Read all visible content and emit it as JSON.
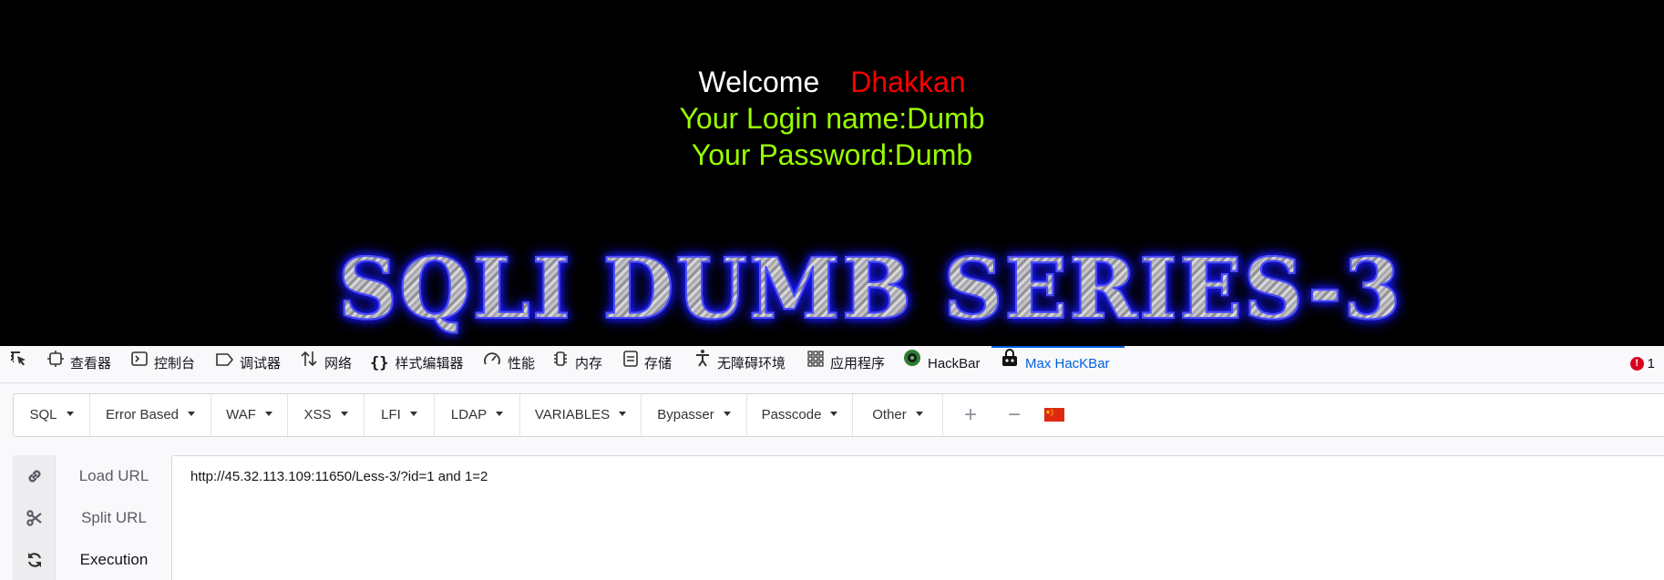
{
  "web": {
    "welcome": "Welcome",
    "username": "Dhakkan",
    "login_name": "Your Login name:Dumb",
    "password": "Your Password:Dumb",
    "banner": "SQLI DUMB SERIES-3"
  },
  "devtools": {
    "tabs": [
      {
        "label": "",
        "icon": "element-picker-icon"
      },
      {
        "label": "查看器",
        "icon": "inspector-icon"
      },
      {
        "label": "控制台",
        "icon": "console-icon"
      },
      {
        "label": "调试器",
        "icon": "debugger-icon"
      },
      {
        "label": "网络",
        "icon": "network-icon"
      },
      {
        "label": "样式编辑器",
        "icon": "style-editor-icon"
      },
      {
        "label": "性能",
        "icon": "performance-icon"
      },
      {
        "label": "内存",
        "icon": "memory-icon"
      },
      {
        "label": "存储",
        "icon": "storage-icon"
      },
      {
        "label": "无障碍环境",
        "icon": "accessibility-icon"
      },
      {
        "label": "应用程序",
        "icon": "application-icon"
      },
      {
        "label": "HackBar",
        "icon": "hackbar-icon"
      },
      {
        "label": "Max HacKBar",
        "icon": "max-hackbar-icon",
        "active": true
      }
    ],
    "error_count": "1",
    "active_color": "#0060df",
    "error_color": "#d70022"
  },
  "hackbar": {
    "menus": [
      "SQL",
      "Error Based",
      "WAF",
      "XSS",
      "LFI",
      "LDAP",
      "VARIABLES",
      "Bypasser",
      "Passcode",
      "Other"
    ],
    "add_button": "+",
    "remove_button": "−",
    "flag_icon": "china-flag-icon",
    "actions": [
      {
        "label": "Load URL",
        "icon": "link-icon"
      },
      {
        "label": "Split URL",
        "icon": "scissors-icon"
      },
      {
        "label": "Execution",
        "icon": "refresh-icon"
      }
    ],
    "url_value": "http://45.32.113.109:11650/Less-3/?id=1 and 1=2"
  }
}
